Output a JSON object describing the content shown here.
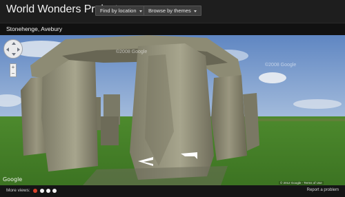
{
  "header": {
    "title": "World Wonders Project",
    "nav": [
      {
        "label": "Find by location"
      },
      {
        "label": "Browse by themes"
      }
    ]
  },
  "location": {
    "title": "Stonehenge, Avebury"
  },
  "viewer": {
    "watermarks": [
      "©2008 Google",
      "©2008 Google"
    ],
    "logo": "Google",
    "terms": "© 2012 Google - Terms of Use",
    "zoom_in": "+",
    "zoom_out": "−"
  },
  "footer": {
    "more_views_label": "More views:",
    "view_dots": [
      {
        "color": "#d9412b",
        "active": true
      },
      {
        "color": "#f2f2f2",
        "active": false
      },
      {
        "color": "#f2f2f2",
        "active": false
      },
      {
        "color": "#f2f2f2",
        "active": false
      }
    ],
    "report_label": "Report a problem"
  },
  "colors": {
    "topbar": "#1e1e1e",
    "sky": "#6f93c9",
    "grass": "#4f8a2a",
    "stone": "#8a8a73",
    "active_dot": "#d9412b"
  }
}
